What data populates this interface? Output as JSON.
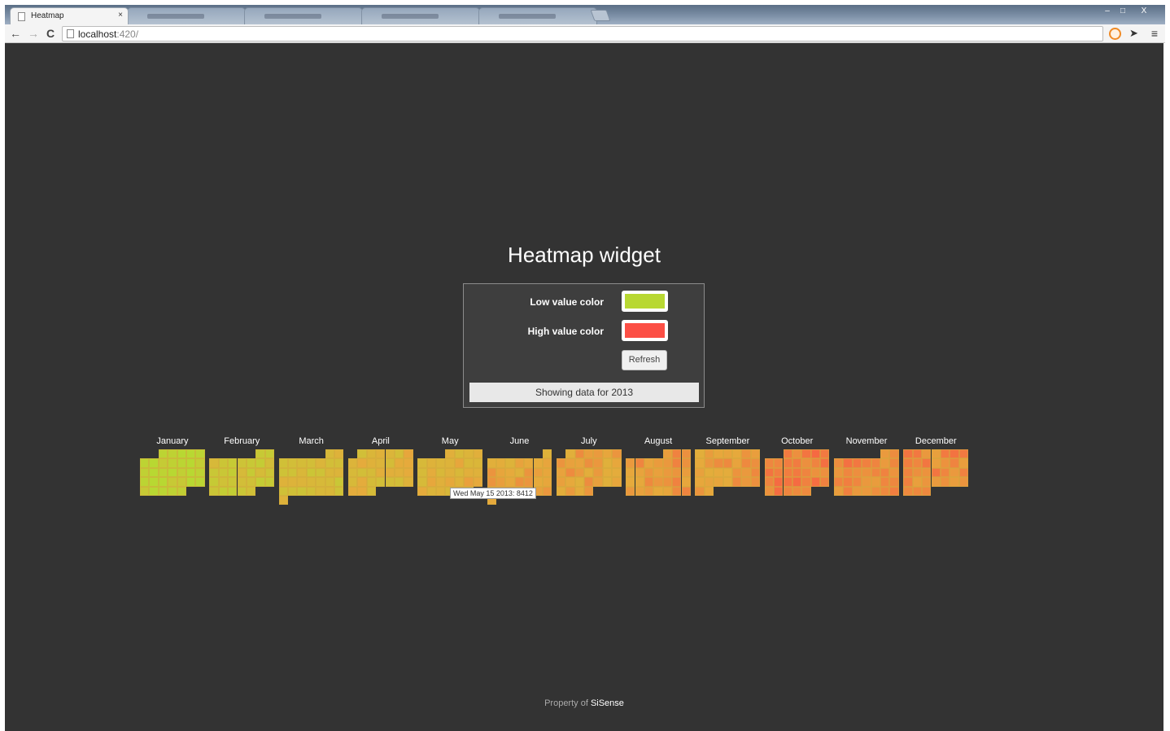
{
  "browser": {
    "active_tab_title": "Heatmap",
    "close_glyph": "×",
    "url_host": "localhost",
    "url_port": ":420/",
    "window_controls": {
      "minimize": "–",
      "maximize": "□",
      "close": "X"
    },
    "nav_icons": {
      "back": "←",
      "forward": "→",
      "reload": "C",
      "menu": "≡"
    },
    "background_tabs": 4
  },
  "page": {
    "title": "Heatmap widget",
    "low_label": "Low value color",
    "high_label": "High value color",
    "low_color": "#b8d832",
    "high_color": "#fc4f45",
    "refresh_label": "Refresh",
    "status": "Showing data for 2013",
    "tooltip": "Wed May 15 2013: 8412",
    "footer_prefix": "Property of ",
    "footer_brand": "SiSense"
  },
  "chart_data": {
    "type": "heatmap",
    "title": "",
    "year": 2013,
    "months": [
      "January",
      "February",
      "March",
      "April",
      "May",
      "June",
      "July",
      "August",
      "September",
      "October",
      "November",
      "December"
    ],
    "scale": {
      "low_color": "#b8d832",
      "high_color": "#fc4f45"
    },
    "monthly_level": [
      0.05,
      0.22,
      0.3,
      0.4,
      0.45,
      0.52,
      0.55,
      0.62,
      0.57,
      0.74,
      0.7,
      0.68
    ],
    "highlighted": {
      "date": "Wed May 15 2013",
      "value": 8412
    }
  }
}
